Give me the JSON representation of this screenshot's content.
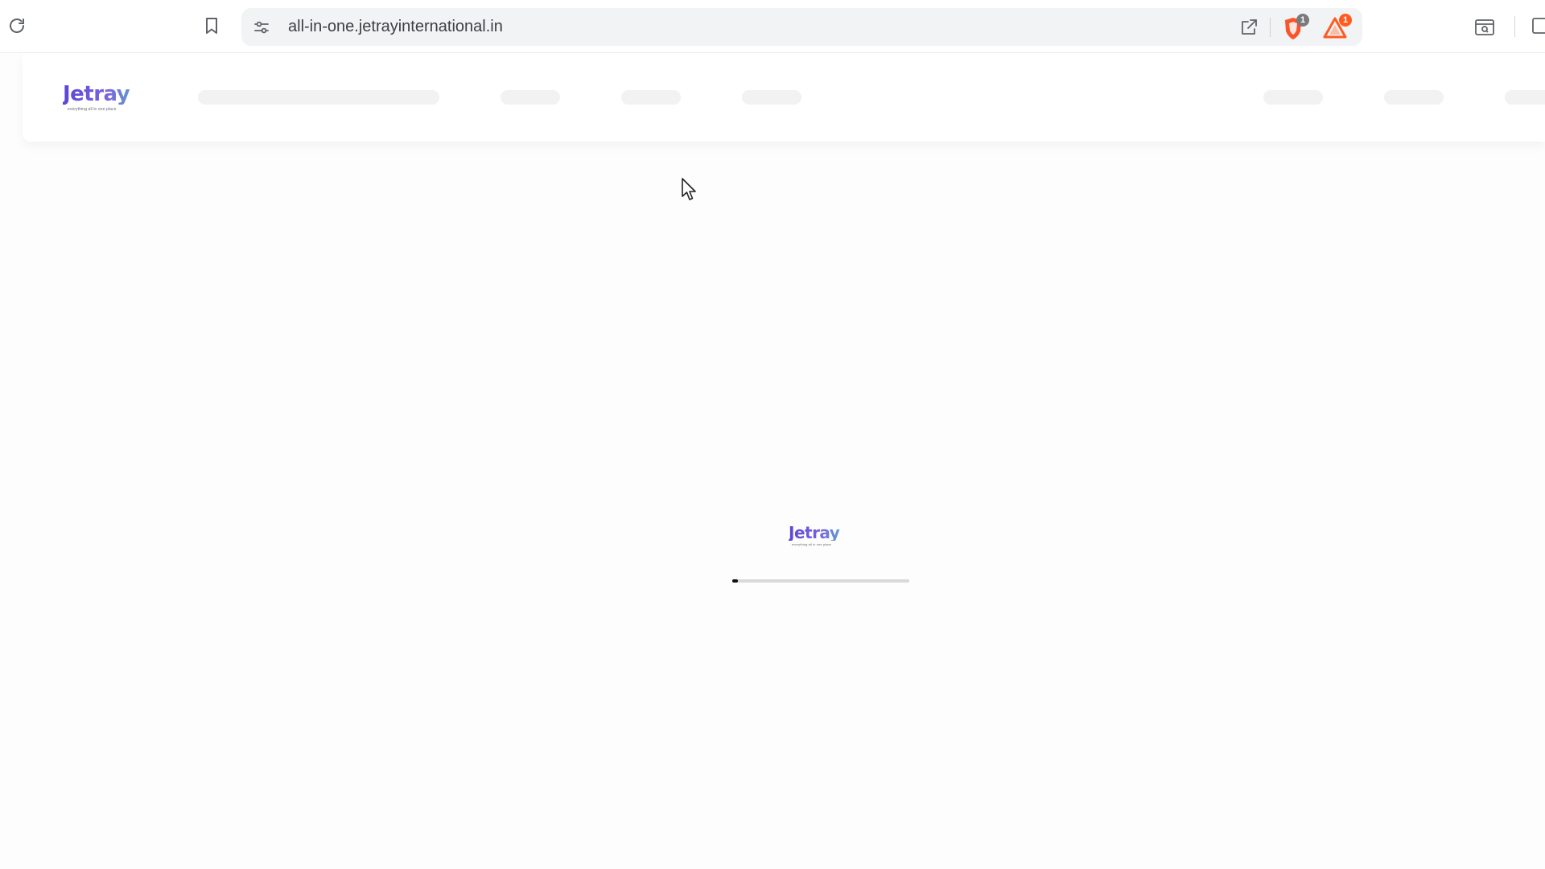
{
  "browser": {
    "url": "all-in-one.jetrayinternational.in",
    "shields_badge": "1",
    "rewards_badge": "1",
    "icons": {
      "reload": "reload-icon",
      "bookmark": "bookmark-icon",
      "site_settings": "tune-icon",
      "share": "share-icon",
      "shields": "brave-shield-icon",
      "rewards": "rewards-triangle-icon",
      "side_panel": "side-panel-icon",
      "window": "window-icon"
    },
    "colors": {
      "shield": "#fb542b",
      "rewards": "#ff5a1f",
      "badge_gray": "#7a7a7a"
    }
  },
  "site": {
    "logo_text": "Jetray",
    "logo_tagline": "everything all in one place",
    "logo_colors": [
      "#5b45d6",
      "#4cc3c5"
    ],
    "nav_placeholders": 7,
    "loading": {
      "logo_text": "Jetray",
      "logo_tagline": "everything all in one place",
      "progress": 0.03
    }
  }
}
